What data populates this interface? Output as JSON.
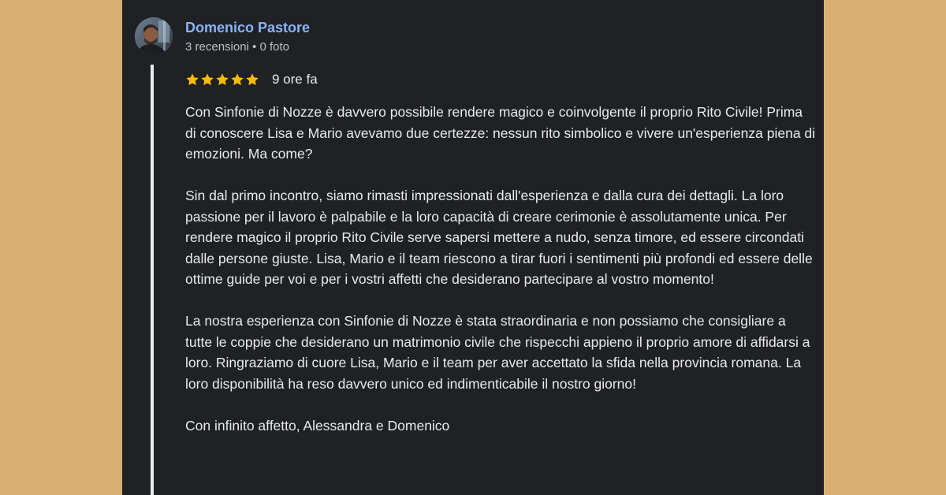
{
  "reviewer": {
    "name": "Domenico Pastore",
    "meta": "3 recensioni • 0 foto"
  },
  "review": {
    "rating": 5,
    "rating_max": 5,
    "star_color": "#fbbc04",
    "time": "9 ore fa",
    "paragraphs": [
      "Con Sinfonie di Nozze è davvero possibile rendere magico e coinvolgente il proprio Rito Civile! Prima di conoscere Lisa e Mario avevamo due certezze: nessun rito simbolico e vivere un'esperienza piena di emozioni. Ma come?",
      "Sin dal primo incontro, siamo rimasti impressionati dall'esperienza e dalla cura dei dettagli. La loro passione per il lavoro è palpabile e la loro capacità di creare cerimonie è assolutamente unica. Per rendere magico il proprio Rito Civile serve sapersi mettere a nudo, senza timore, ed essere circondati dalle persone giuste. Lisa, Mario e il team riescono a tirar fuori i sentimenti più profondi ed essere delle ottime guide per voi e per i vostri affetti che desiderano partecipare al vostro momento!",
      "La nostra esperienza con Sinfonie di Nozze è stata straordinaria e non possiamo che consigliare a tutte le coppie che desiderano un matrimonio civile che rispecchi appieno il proprio amore di affidarsi a loro. Ringraziamo di cuore Lisa, Mario e il team per aver accettato la sfida nella provincia romana. La loro disponibilità ha reso davvero unico ed indimenticabile il nostro giorno!",
      "Con infinito affetto, Alessandra e Domenico"
    ]
  },
  "colors": {
    "page_background": "#d9ae72",
    "card_background": "#202124",
    "name_color": "#8ab4f8",
    "text_color": "#e8eaed",
    "meta_color": "#bdc1c6"
  }
}
